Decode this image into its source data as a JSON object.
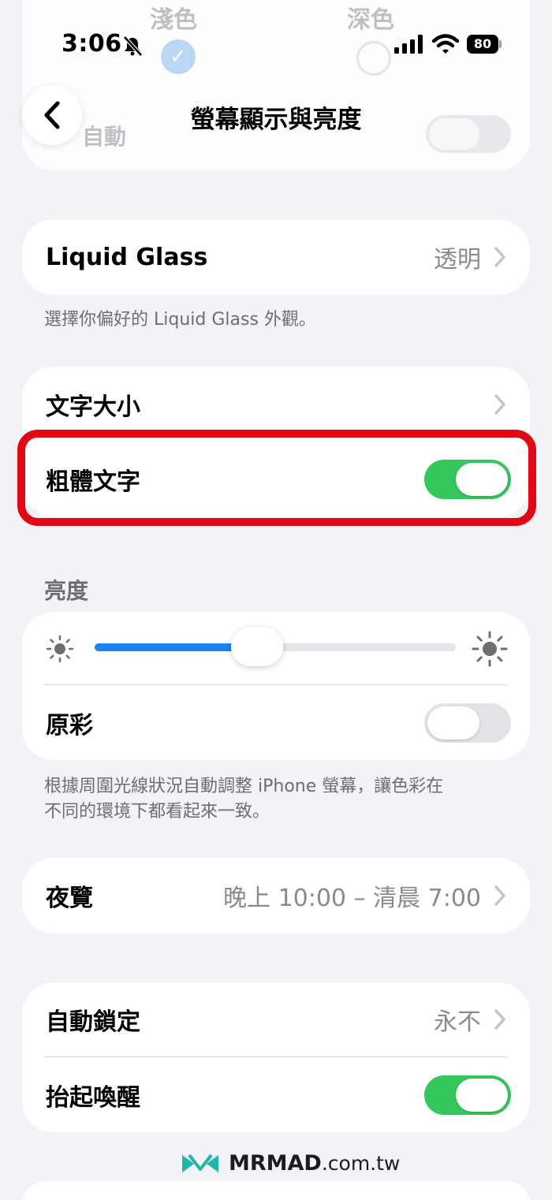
{
  "status_bar": {
    "time": "3:06",
    "battery": "80"
  },
  "ghost": {
    "left_label": "淺色",
    "right_label": "深色",
    "row_label": "自動"
  },
  "nav": {
    "title": "螢幕顯示與亮度"
  },
  "liquid_glass": {
    "label": "Liquid Glass",
    "value": "透明",
    "caption": "選擇你偏好的 Liquid Glass 外觀。"
  },
  "text": {
    "size_label": "文字大小",
    "bold_label": "粗體文字",
    "bold_on": true
  },
  "brightness": {
    "header": "亮度",
    "level": 0.45,
    "true_tone_label": "原彩",
    "true_tone_on": false,
    "caption_line1": "根據周圍光線狀況自動調整 iPhone 螢幕，讓色彩在",
    "caption_line2": "不同的環境下都看起來一致。"
  },
  "night_shift": {
    "label": "夜覽",
    "value": "晚上 10:00 – 清晨 7:00"
  },
  "lock": {
    "auto_lock_label": "自動鎖定",
    "auto_lock_value": "永不",
    "raise_to_wake_label": "抬起喚醒",
    "raise_to_wake_on": true
  },
  "watermark": {
    "brand": "MRMAD",
    "domain": ".com.tw"
  },
  "colors": {
    "toggle_on": "#34c759",
    "slider_fill": "#1a84f4",
    "highlight": "#e30613"
  }
}
